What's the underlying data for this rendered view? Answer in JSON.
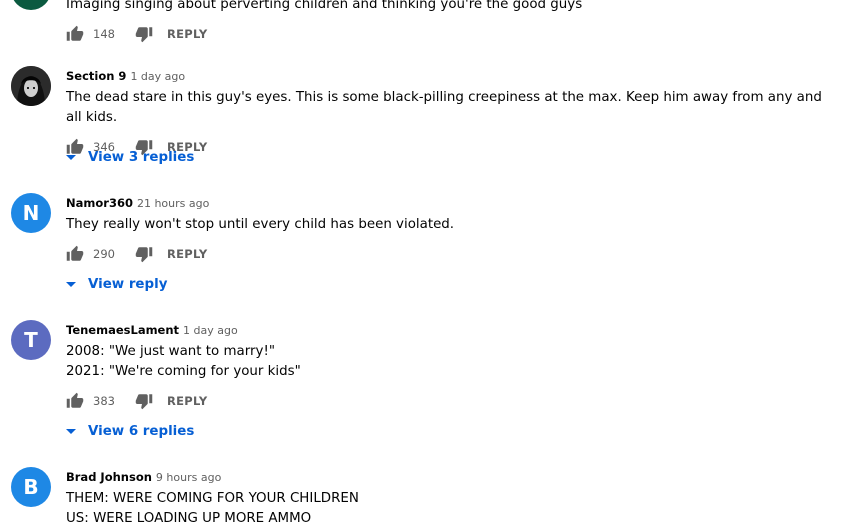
{
  "comments": [
    {
      "author": "",
      "time": "",
      "avatar_letter": "",
      "avatar_color": "#0b5a40",
      "text": "Imaging singing about perverting children and thinking you're the good guys",
      "likes": "148",
      "reply_label": "REPLY",
      "view_replies": ""
    },
    {
      "author": "Section 9",
      "time": "1 day ago",
      "avatar_letter": "",
      "avatar_color": "#3a3a3a",
      "text": "The dead stare in this guy's eyes. This is some black-pilling creepiness at the max. Keep him away from any and all kids.",
      "likes": "346",
      "reply_label": "REPLY",
      "view_replies": "View 3 replies"
    },
    {
      "author": "Namor360",
      "time": "21 hours ago",
      "avatar_letter": "N",
      "avatar_color": "#1e88e5",
      "text": "They really won't stop until every child has been violated.",
      "likes": "290",
      "reply_label": "REPLY",
      "view_replies": "View reply"
    },
    {
      "author": "TenemaesLament",
      "time": "1 day ago",
      "avatar_letter": "T",
      "avatar_color": "#5c6bc0",
      "text": "2008: \"We just want to marry!\"\n2021: \"We're coming for your kids\"",
      "likes": "383",
      "reply_label": "REPLY",
      "view_replies": "View 6 replies"
    },
    {
      "author": "Brad Johnson",
      "time": "9 hours ago",
      "avatar_letter": "B",
      "avatar_color": "#1e88e5",
      "text": "THEM: WERE COMING FOR YOUR CHILDREN\nUS: WERE LOADING UP MORE AMMO",
      "likes": "",
      "reply_label": "",
      "view_replies": ""
    }
  ],
  "icons": {
    "like": "thumb-up-icon",
    "dislike": "thumb-down-icon",
    "caret": "caret-down-icon"
  }
}
